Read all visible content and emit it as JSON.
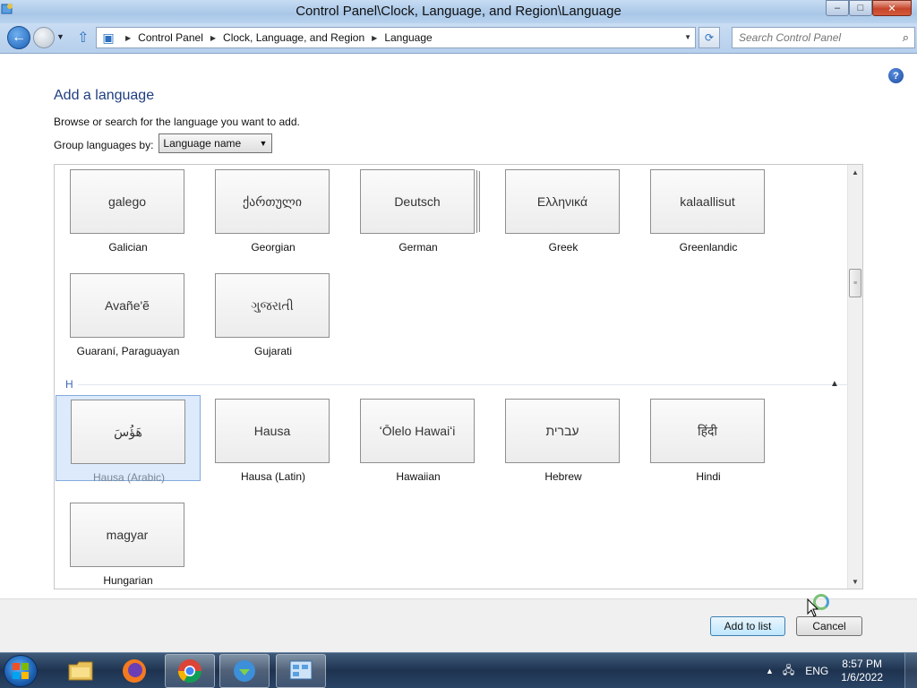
{
  "window": {
    "title": "Control Panel\\Clock, Language, and Region\\Language",
    "minimize": "–",
    "maximize": "□",
    "close": "✕"
  },
  "address": {
    "crumbs": [
      "Control Panel",
      "Clock, Language, and Region",
      "Language"
    ],
    "search_placeholder": "Search Control Panel"
  },
  "page": {
    "title": "Add a language",
    "instruction": "Browse or search for the language you want to add.",
    "group_by_label": "Group languages by:",
    "group_by_value": "Language name",
    "help": "?"
  },
  "languages": {
    "g_row1": [
      {
        "native": "galego",
        "name": "Galician"
      },
      {
        "native": "ქართული",
        "name": "Georgian"
      },
      {
        "native": "Deutsch",
        "name": "German"
      },
      {
        "native": "Ελληνικά",
        "name": "Greek"
      },
      {
        "native": "kalaallisut",
        "name": "Greenlandic"
      }
    ],
    "g_row2": [
      {
        "native": "Avañe'ẽ",
        "name": "Guaraní, Paraguayan"
      },
      {
        "native": "ગુજરાતી",
        "name": "Gujarati"
      }
    ],
    "h_header": "H",
    "h_row1": [
      {
        "native": "هَؤُسَ",
        "name": "Hausa (Arabic)"
      },
      {
        "native": "Hausa",
        "name": "Hausa (Latin)"
      },
      {
        "native": "ʻŌlelo Hawaiʻi",
        "name": "Hawaiian"
      },
      {
        "native": "עברית",
        "name": "Hebrew"
      },
      {
        "native": "हिंदी",
        "name": "Hindi"
      }
    ],
    "h_row2": [
      {
        "native": "magyar",
        "name": "Hungarian"
      }
    ]
  },
  "buttons": {
    "add": "Add to list",
    "cancel": "Cancel"
  },
  "taskbar": {
    "lang": "ENG",
    "time": "8:57 PM",
    "date": "1/6/2022"
  },
  "colors": {
    "title_text": "#1e3e7f",
    "selection": "#dceafb"
  }
}
